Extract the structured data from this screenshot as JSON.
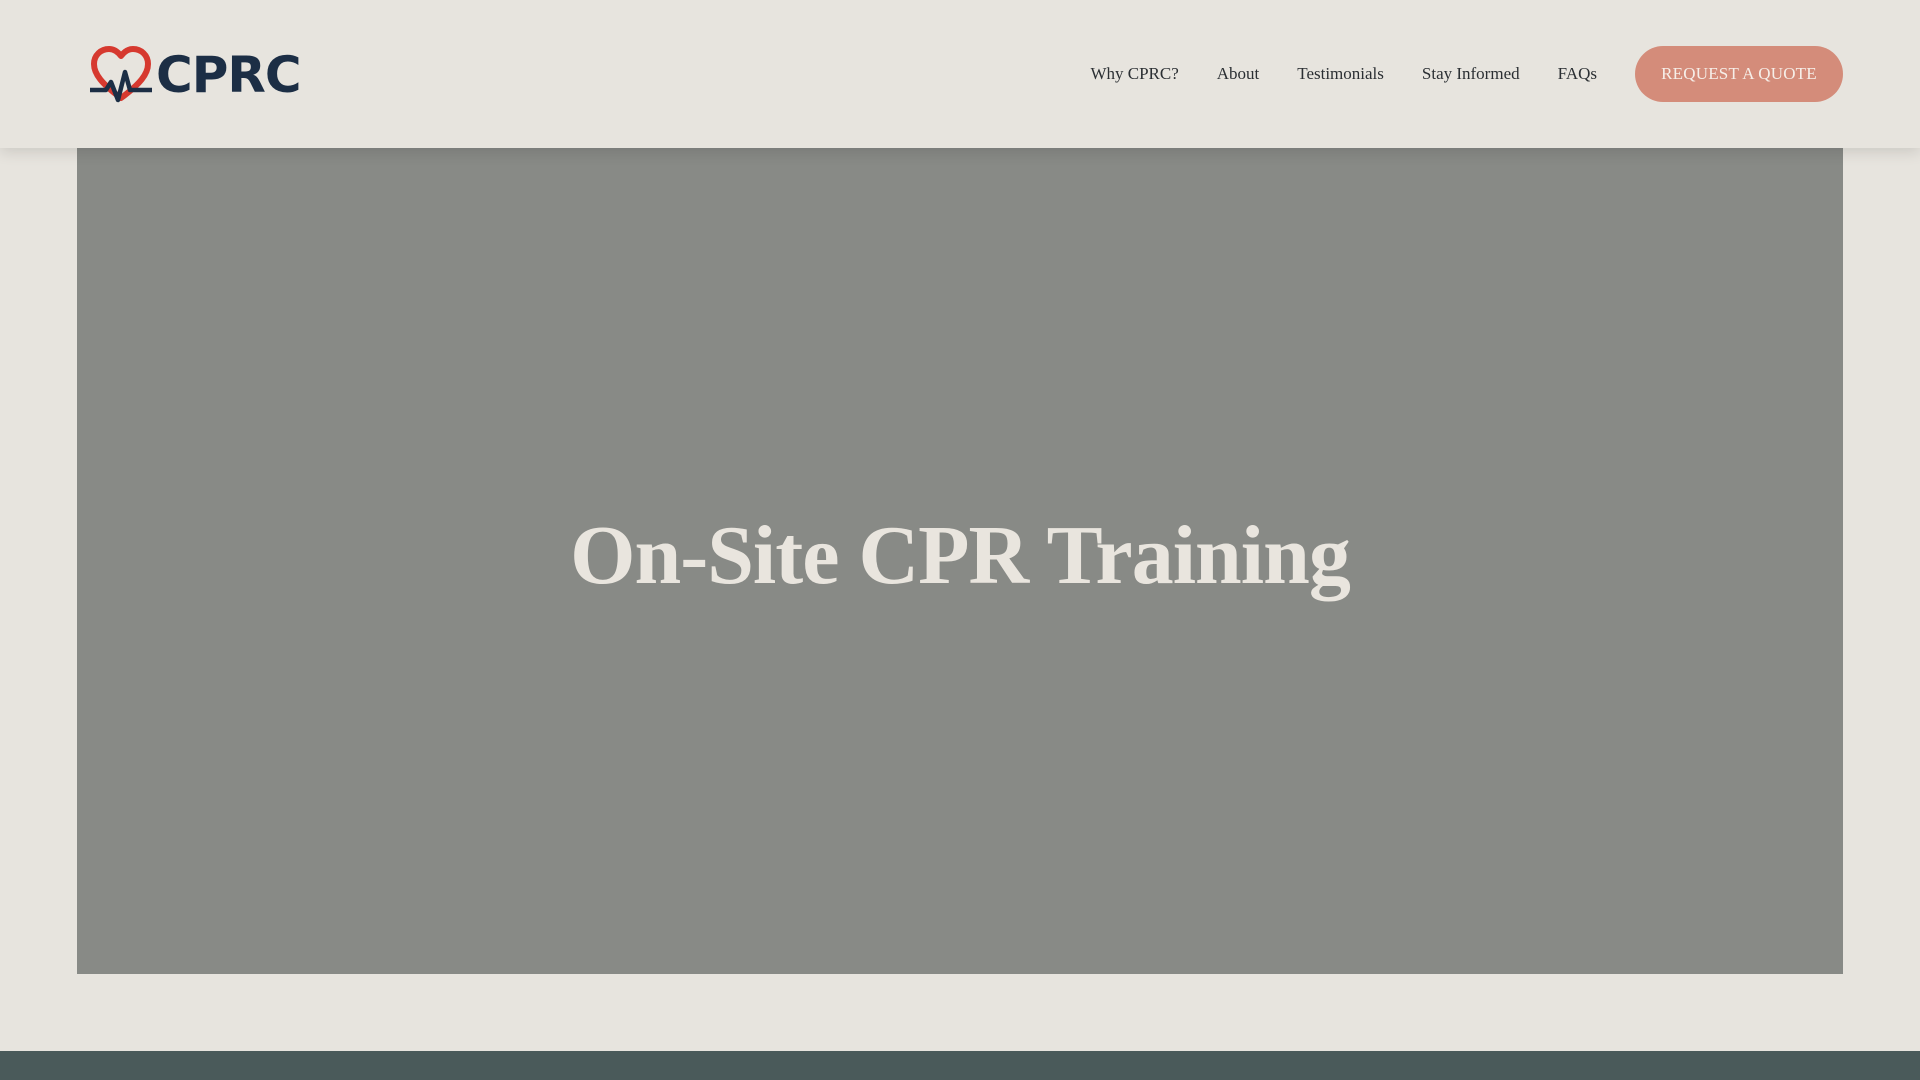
{
  "header": {
    "logo_text": "CPRC",
    "logo_icon": "heart-pulse-icon",
    "nav": [
      {
        "label": "Why CPRC?"
      },
      {
        "label": "About"
      },
      {
        "label": "Testimonials"
      },
      {
        "label": "Stay Informed"
      },
      {
        "label": "FAQs"
      }
    ],
    "cta_label": "REQUEST A QUOTE"
  },
  "hero": {
    "title": "On-Site CPR Training"
  },
  "colors": {
    "background": "#e7e4de",
    "brand_red": "#d6392f",
    "brand_navy": "#1c2e45",
    "cta": "#d48c7a",
    "hero_overlay": "#888a86",
    "footer": "#4a5a5a"
  }
}
